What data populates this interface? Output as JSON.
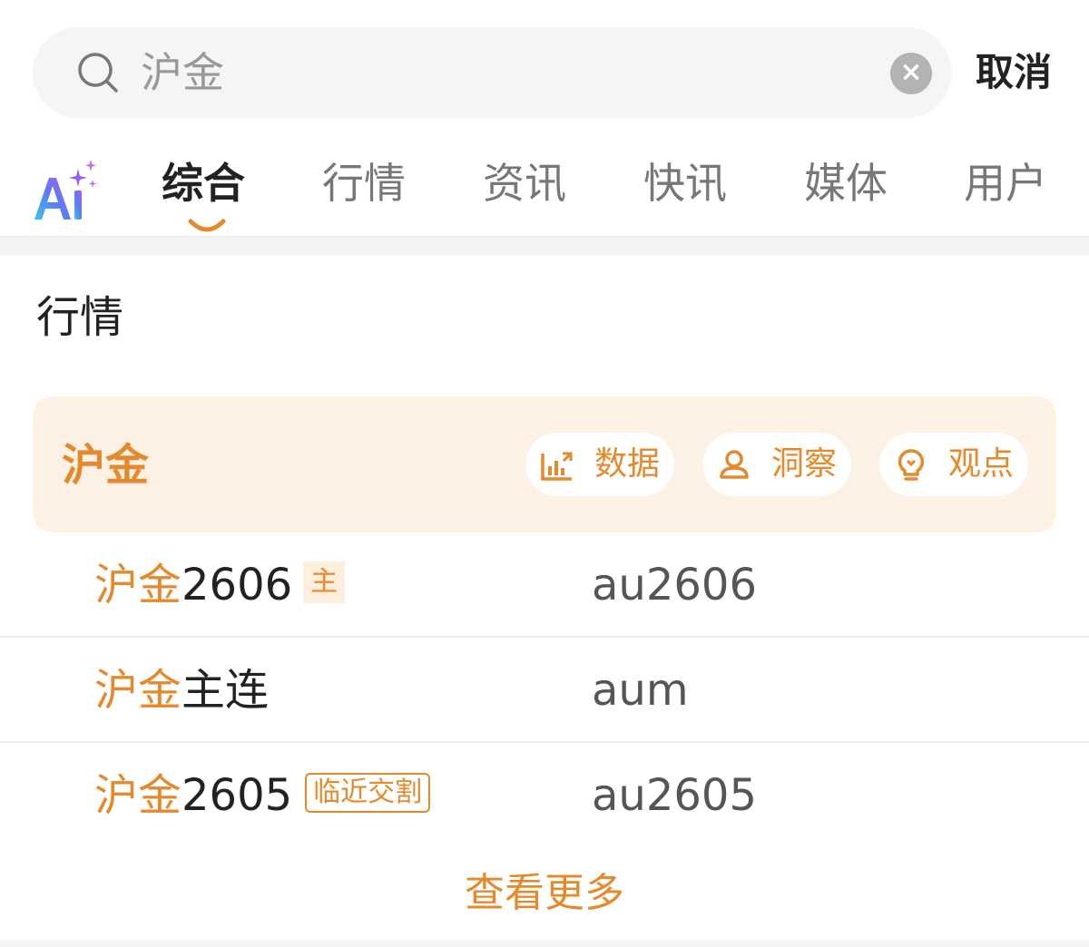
{
  "search": {
    "query": "沪金",
    "cancel_label": "取消"
  },
  "tabs": [
    {
      "label": "综合",
      "active": true
    },
    {
      "label": "行情",
      "active": false
    },
    {
      "label": "资讯",
      "active": false
    },
    {
      "label": "快讯",
      "active": false
    },
    {
      "label": "媒体",
      "active": false
    },
    {
      "label": "用户",
      "active": false
    }
  ],
  "icons": {
    "search": "search-icon",
    "clear": "close-icon",
    "ai": "ai-sparkle-icon",
    "data": "chart-icon",
    "insight": "person-icon",
    "opinion": "lightbulb-icon"
  },
  "section": {
    "title": "行情",
    "card": {
      "title": "沪金",
      "actions": [
        {
          "label": "数据"
        },
        {
          "label": "洞察"
        },
        {
          "label": "观点"
        }
      ]
    },
    "rows": [
      {
        "highlight": "沪金",
        "rest": "2606",
        "badge": "主",
        "badge_style": "filled",
        "code": "au2606"
      },
      {
        "highlight": "沪金",
        "rest": "主连",
        "badge": "",
        "badge_style": "none",
        "code": "aum"
      },
      {
        "highlight": "沪金",
        "rest": "2605",
        "badge": "临近交割",
        "badge_style": "outline",
        "code": "au2605"
      }
    ],
    "more_label": "查看更多"
  },
  "colors": {
    "accent": "#e58a2c",
    "card_bg": "#fdf1e5",
    "search_bg": "#f5f5f5"
  }
}
